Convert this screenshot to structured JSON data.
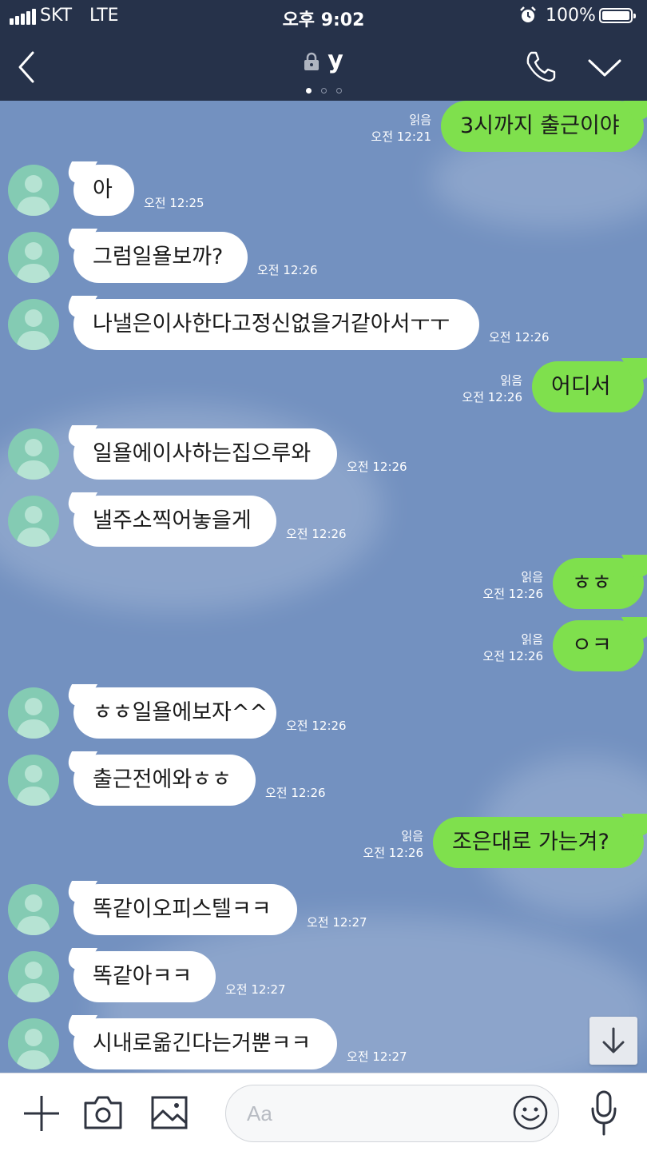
{
  "status_bar": {
    "carrier": "SKT",
    "network": "LTE",
    "time": "오후 9:02",
    "battery": "100%"
  },
  "header": {
    "title": "y"
  },
  "messages": [
    {
      "side": "out",
      "text": "3시까지 출근이야",
      "read": "읽음",
      "time": "오전 12:21"
    },
    {
      "side": "in",
      "text": "아",
      "time": "오전 12:25"
    },
    {
      "side": "in",
      "text": "그럼일욜보까?",
      "time": "오전 12:26"
    },
    {
      "side": "in",
      "text": "나낼은이사한다고정신없을거같아서ㅜㅜ",
      "time": "오전 12:26"
    },
    {
      "side": "out",
      "text": "어디서",
      "read": "읽음",
      "time": "오전 12:26"
    },
    {
      "side": "in",
      "text": "일욜에이사하는집으루와",
      "time": "오전 12:26"
    },
    {
      "side": "in",
      "text": "낼주소찍어놓을게",
      "time": "오전 12:26"
    },
    {
      "side": "out",
      "text": "ㅎㅎ",
      "read": "읽음",
      "time": "오전 12:26"
    },
    {
      "side": "out",
      "text": "ㅇㅋ",
      "read": "읽음",
      "time": "오전 12:26"
    },
    {
      "side": "in",
      "text": "ㅎㅎ일욜에보자^^",
      "time": "오전 12:26"
    },
    {
      "side": "in",
      "text": "출근전에와ㅎㅎ",
      "time": "오전 12:26"
    },
    {
      "side": "out",
      "text": "조은대로 가는겨?",
      "read": "읽음",
      "time": "오전 12:26"
    },
    {
      "side": "in",
      "text": "똑같이오피스텔ㅋㅋ",
      "time": "오전 12:27"
    },
    {
      "side": "in",
      "text": "똑같아ㅋㅋ",
      "time": "오전 12:27"
    },
    {
      "side": "in",
      "text": "시내로옮긴다는거뿐ㅋㅋ",
      "time": "오전 12:27"
    }
  ],
  "input": {
    "placeholder": "Aa"
  },
  "colors": {
    "header_bg": "#26324a",
    "chat_bg": "#7391c0",
    "outgoing_bubble": "#7fe04d",
    "incoming_bubble": "#ffffff",
    "avatar_bg": "#84cbb3"
  },
  "icons": {
    "back": "chevron-left-icon",
    "lock": "lock-icon",
    "call": "phone-icon",
    "menu": "chevron-down-icon",
    "add": "plus-icon",
    "camera": "camera-icon",
    "gallery": "image-icon",
    "emoji": "smiley-icon",
    "voice": "microphone-icon",
    "scroll": "arrow-down-icon"
  }
}
